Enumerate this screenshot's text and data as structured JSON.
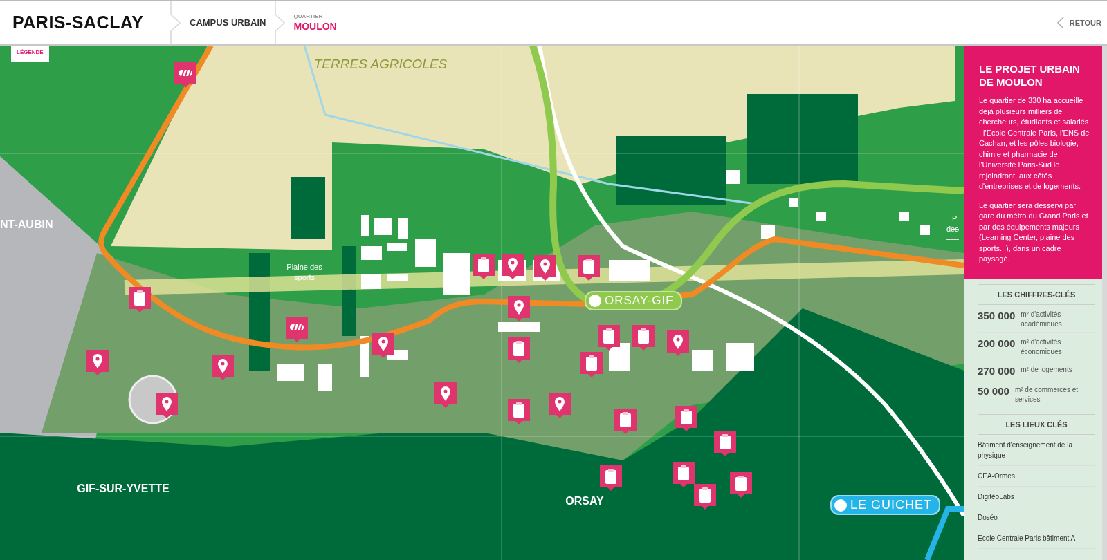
{
  "header": {
    "logo": "PARIS-SACLAY",
    "breadcrumb": [
      {
        "label": "CAMPUS URBAIN",
        "selected": false
      },
      {
        "caption": "QUARTIER",
        "label": "MOULON",
        "selected": true
      }
    ],
    "back_link": "RETOUR"
  },
  "legend_tab": "LÉGENDE",
  "map": {
    "labels": [
      {
        "text": "TERRES AGRICOLES",
        "kind": "area"
      },
      {
        "text": "NT-AUBIN",
        "kind": "town"
      },
      {
        "text": "Plaine des sports",
        "kind": "place"
      },
      {
        "text": "GIF-SUR-YVETTE",
        "kind": "town"
      },
      {
        "text": "ORSAY",
        "kind": "town"
      },
      {
        "text": "Pl",
        "kind": "place"
      },
      {
        "text": "des",
        "kind": "place"
      }
    ],
    "stations": [
      {
        "name": "ORSAY-GIF",
        "kind": "green"
      },
      {
        "name": "LE GUICHET",
        "kind": "blue"
      }
    ],
    "markers": [
      {
        "kind": "barrier"
      },
      {
        "kind": "clipboard"
      },
      {
        "kind": "barrier"
      },
      {
        "kind": "location"
      },
      {
        "kind": "location"
      },
      {
        "kind": "location"
      },
      {
        "kind": "location"
      },
      {
        "kind": "location"
      },
      {
        "kind": "clipboard"
      },
      {
        "kind": "location"
      },
      {
        "kind": "location"
      },
      {
        "kind": "clipboard"
      },
      {
        "kind": "location"
      },
      {
        "kind": "clipboard"
      },
      {
        "kind": "clipboard"
      },
      {
        "kind": "location"
      },
      {
        "kind": "clipboard"
      },
      {
        "kind": "clipboard"
      },
      {
        "kind": "location"
      },
      {
        "kind": "clipboard"
      },
      {
        "kind": "clipboard"
      },
      {
        "kind": "clipboard"
      },
      {
        "kind": "clipboard"
      },
      {
        "kind": "clipboard"
      },
      {
        "kind": "clipboard"
      },
      {
        "kind": "clipboard"
      },
      {
        "kind": "clipboard"
      }
    ]
  },
  "panel": {
    "title": "LE PROJET URBAIN DE MOULON",
    "paragraphs": [
      "Le quartier de 330 ha accueille déjà plusieurs milliers de chercheurs, étudiants et salariés : l'Ecole Centrale Paris, l'ENS de Cachan, et les pôles biologie, chimie et pharmacie de l'Université Paris-Sud le rejoindront, aux côtés d'entreprises et de logements.",
      "Le quartier sera desservi par gare du métro du Grand Paris et par des équipements majeurs (Learning Center, plaine des sports...), dans un cadre paysagé."
    ],
    "figures_title": "LES CHIFFRES-CLÉS",
    "figures": [
      {
        "value": "350 000",
        "label": "m² d'activités académiques"
      },
      {
        "value": "200 000",
        "label": "m² d'activités économiques"
      },
      {
        "value": "270 000",
        "label": "m² de logements"
      },
      {
        "value": "50 000",
        "label": "m² de commerces et services"
      }
    ],
    "places_title": "LES LIEUX CLÉS",
    "places": [
      "Bâtiment d'enseignement de la physique",
      "CEA-Ormes",
      "DigitéoLabs",
      "Doséo",
      "Ecole Centrale Paris bâtiment A"
    ]
  }
}
